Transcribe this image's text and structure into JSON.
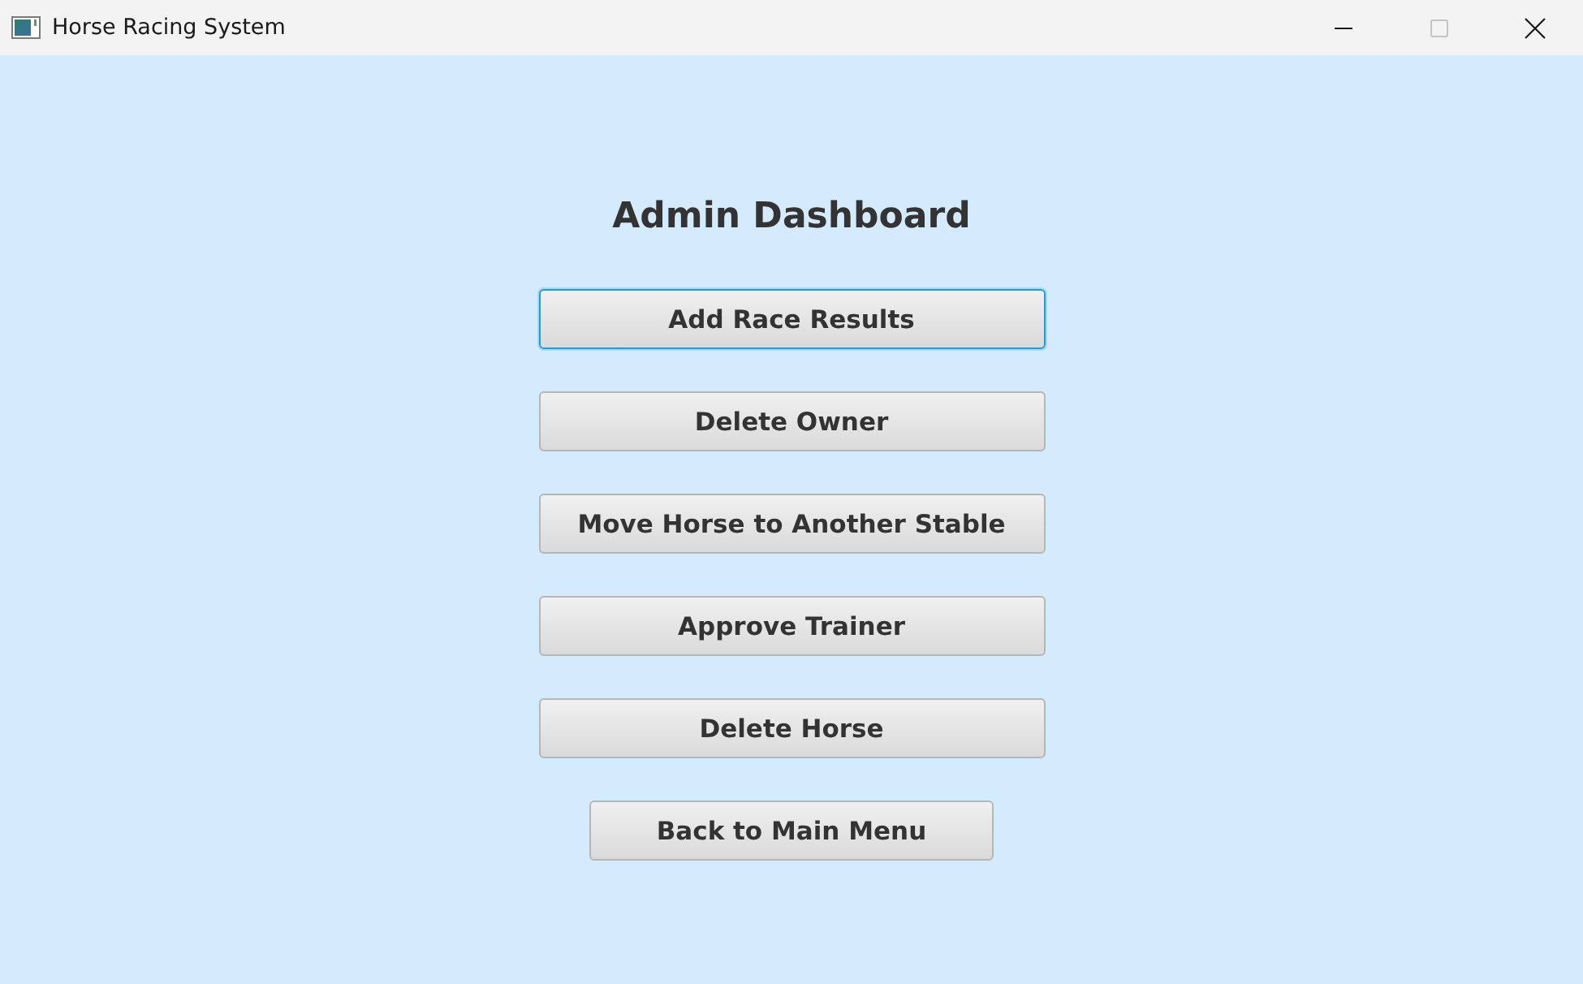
{
  "window": {
    "title": "Horse Racing System",
    "controls": [
      {
        "kind": "minimize",
        "disabled": false
      },
      {
        "kind": "maximize",
        "disabled": true
      },
      {
        "kind": "close",
        "disabled": false
      }
    ]
  },
  "heading": "Admin Dashboard",
  "actions": [
    {
      "label": "Add Race Results",
      "focused": true
    },
    {
      "label": "Delete Owner",
      "focused": false
    },
    {
      "label": "Move Horse to Another Stable",
      "focused": false
    },
    {
      "label": "Approve Trainer",
      "focused": false
    },
    {
      "label": "Delete Horse",
      "focused": false
    }
  ],
  "back_button": {
    "label": "Back to Main Menu",
    "focused": false
  }
}
